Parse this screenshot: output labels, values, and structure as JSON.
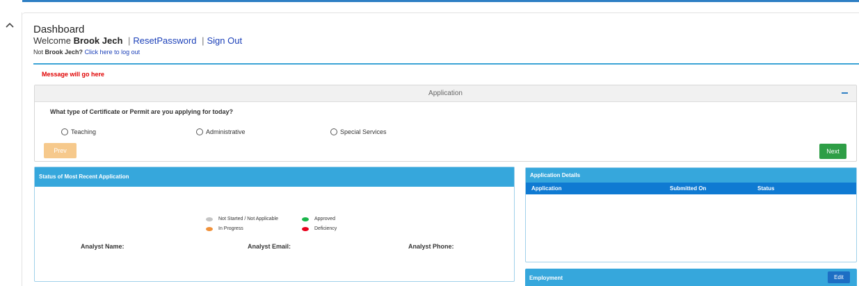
{
  "header": {
    "title": "Dashboard",
    "welcome_prefix": "Welcome",
    "user_name": "Brook Jech",
    "reset_password_label": "ResetPassword",
    "sign_out_label": "Sign Out",
    "not_user_prefix": "Not",
    "not_user_name": "Brook Jech?",
    "logout_link": "Click here to log out"
  },
  "message": "Message will go here",
  "application": {
    "panel_title": "Application",
    "question": "What type of Certificate or Permit are you applying for today?",
    "options": [
      "Teaching",
      "Administrative",
      "Special Services"
    ],
    "prev_label": "Prev",
    "next_label": "Next"
  },
  "status": {
    "title": "Status of Most Recent Application",
    "legend": [
      {
        "label": "Not Started / Not Applicable",
        "color": "#c4c4c4"
      },
      {
        "label": "Approved",
        "color": "#19b54a"
      },
      {
        "label": "In Progress",
        "color": "#f0913a"
      },
      {
        "label": "Deficiency",
        "color": "#e8001c"
      }
    ],
    "analyst_name_label": "Analyst Name:",
    "analyst_email_label": "Analyst Email:",
    "analyst_phone_label": "Analyst Phone:"
  },
  "details": {
    "title": "Application Details",
    "columns": [
      "Application",
      "Submitted On",
      "Status"
    ]
  },
  "employment": {
    "title": "Employment",
    "edit_label": "Edit"
  },
  "colors": {
    "accent": "#36a7dc",
    "next": "#2e9e46",
    "prev": "#f6c98c",
    "message": "#e00000"
  }
}
